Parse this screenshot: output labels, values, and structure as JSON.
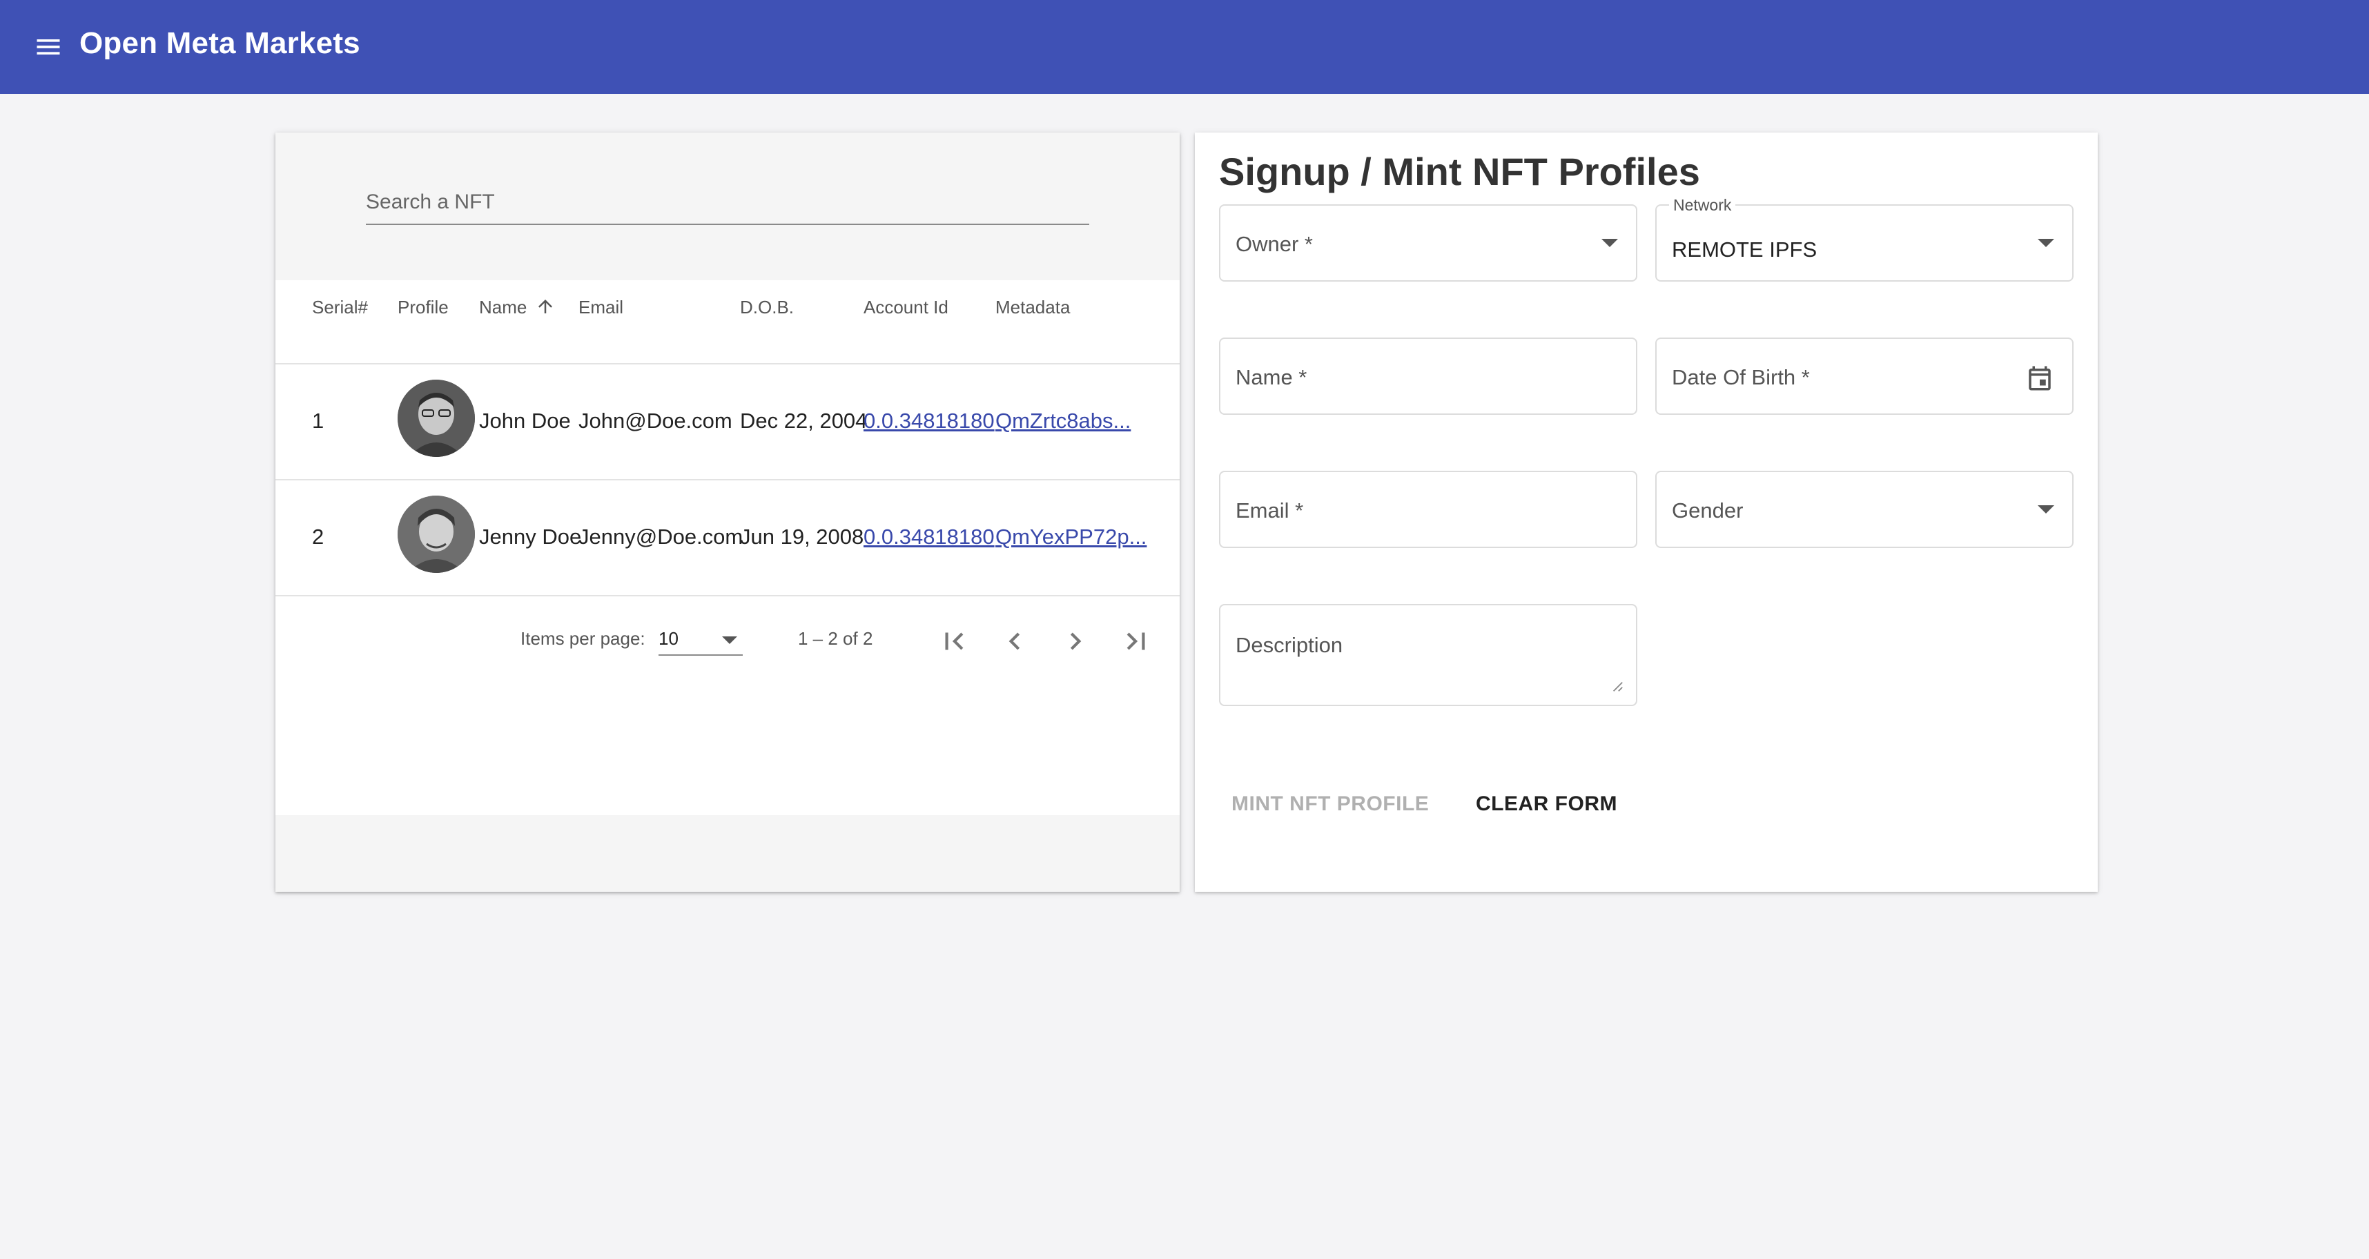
{
  "app": {
    "title": "Open Meta Markets"
  },
  "search": {
    "placeholder": "Search a NFT"
  },
  "table": {
    "columns": [
      "Serial#",
      "Profile",
      "Name",
      "Email",
      "D.O.B.",
      "Account Id",
      "Metadata"
    ],
    "rows": [
      {
        "serial": "1",
        "name": "John Doe",
        "email": "John@Doe.com",
        "dob": "Dec 22, 2004",
        "account_id": "0.0.34818180",
        "metadata": "QmZrtc8abs..."
      },
      {
        "serial": "2",
        "name": "Jenny Doe",
        "email": "Jenny@Doe.com",
        "dob": "Jun 19, 2008",
        "account_id": "0.0.34818180",
        "metadata": "QmYexPP72p..."
      }
    ]
  },
  "paginator": {
    "items_per_page_label": "Items per page:",
    "page_size": "10",
    "range_label": "1 – 2 of 2"
  },
  "form": {
    "title": "Signup / Mint NFT Profiles",
    "owner_label": "Owner *",
    "network_label": "Network",
    "network_value": "REMOTE IPFS",
    "name_label": "Name *",
    "dob_label": "Date Of Birth *",
    "email_label": "Email *",
    "gender_label": "Gender",
    "description_label": "Description",
    "mint_button": "MINT NFT PROFILE",
    "clear_button": "CLEAR FORM"
  },
  "icons": {
    "menu": "menu-icon",
    "sort": "arrow-up-icon",
    "first_page": "first-page-icon",
    "prev_page": "chevron-left-icon",
    "next_page": "chevron-right-icon",
    "last_page": "last-page-icon",
    "calendar": "calendar-icon"
  },
  "colors": {
    "primary": "#3f51b5",
    "link": "#3949ab",
    "disabled": "#b0b0b0"
  }
}
